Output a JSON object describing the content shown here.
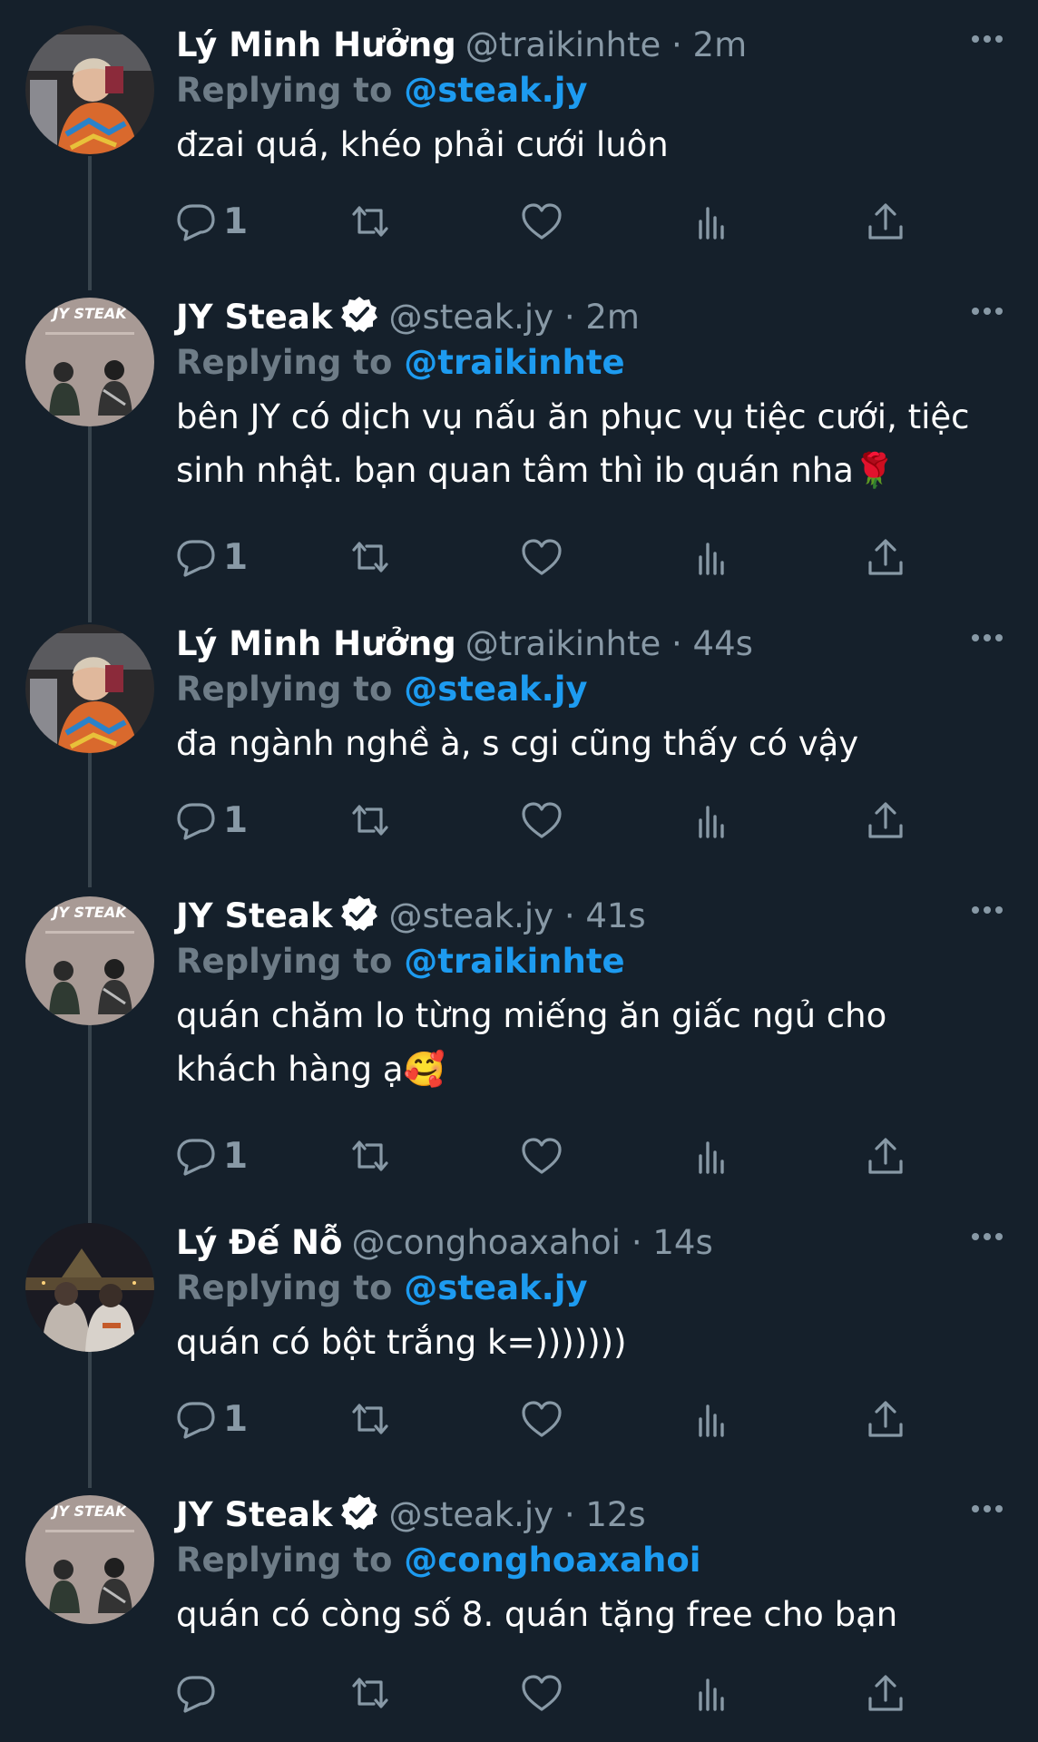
{
  "tweets": [
    {
      "name": "Lý Minh Hưởng",
      "verified": false,
      "handle": "@traikinhte",
      "time": "2m",
      "replying_prefix": "Replying to",
      "replying_to": "@steak.jy",
      "text_lines": [
        "đzai quá, khéo phải cưới luôn"
      ],
      "reply_count": "1",
      "avatar": "user-photo-colorful-sweater"
    },
    {
      "name": "JY Steak",
      "verified": true,
      "handle": "@steak.jy",
      "time": "2m",
      "replying_prefix": "Replying to",
      "replying_to": "@traikinhte",
      "text_lines": [
        "bên JY có dịch vụ nấu ăn phục vụ tiệc cưới, tiệc",
        "sinh nhật. bạn quan tâm thì ib quán nha🌹"
      ],
      "reply_count": "1",
      "avatar": "jy-steak-logo",
      "avatar_label": "JY STEAK"
    },
    {
      "name": "Lý Minh Hưởng",
      "verified": false,
      "handle": "@traikinhte",
      "time": "44s",
      "replying_prefix": "Replying to",
      "replying_to": "@steak.jy",
      "text_lines": [
        "đa ngành nghề à, s cgi cũng thấy có vậy"
      ],
      "reply_count": "1",
      "avatar": "user-photo-colorful-sweater"
    },
    {
      "name": "JY Steak",
      "verified": true,
      "handle": "@steak.jy",
      "time": "41s",
      "replying_prefix": "Replying to",
      "replying_to": "@traikinhte",
      "text_lines": [
        "quán chăm lo từng miếng ăn giấc ngủ cho",
        "khách hàng ạ🥰"
      ],
      "reply_count": "1",
      "avatar": "jy-steak-logo",
      "avatar_label": "JY STEAK"
    },
    {
      "name": "Lý Đế Nỗ",
      "verified": false,
      "handle": "@conghoaxahoi",
      "time": "14s",
      "replying_prefix": "Replying to",
      "replying_to": "@steak.jy",
      "text_lines": [
        "quán có bột trắng k=)))))))"
      ],
      "reply_count": "1",
      "avatar": "user-photo-night-louvre"
    },
    {
      "name": "JY Steak",
      "verified": true,
      "handle": "@steak.jy",
      "time": "12s",
      "replying_prefix": "Replying to",
      "replying_to": "@conghoaxahoi",
      "text_lines": [
        "quán có còng số 8. quán tặng free cho bạn"
      ],
      "reply_count": "",
      "avatar": "jy-steak-logo",
      "avatar_label": "JY STEAK"
    }
  ],
  "separator": "·",
  "icons": [
    "more-icon",
    "reply-icon",
    "retweet-icon",
    "like-icon",
    "views-icon",
    "share-icon",
    "verified-badge-icon"
  ],
  "colors": {
    "background": "#15202b",
    "text": "#ffffff",
    "muted": "#8899a6",
    "link": "#1d9bf0",
    "thread_line": "#38444d"
  }
}
